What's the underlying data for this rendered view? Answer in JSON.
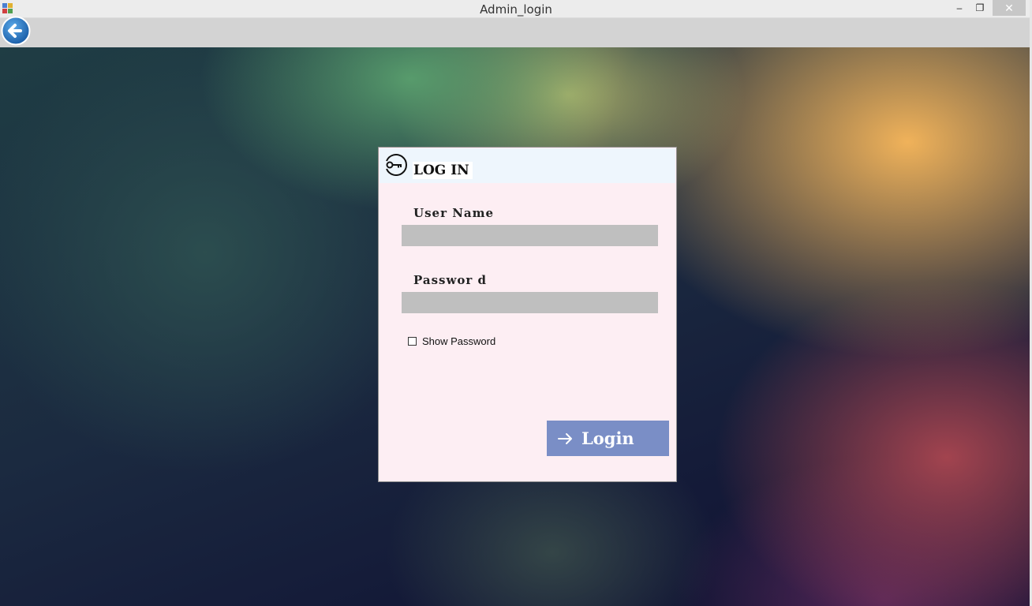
{
  "window": {
    "title": "Admin_login",
    "controls": {
      "minimize": "–",
      "maximize": "❐",
      "close": "✕"
    }
  },
  "toolbar": {
    "back_icon": "back-arrow-icon"
  },
  "login_panel": {
    "header_icon": "key-icon",
    "title": "LOG IN",
    "username": {
      "label": "User Name",
      "value": ""
    },
    "password": {
      "label": "Passwor d",
      "value": ""
    },
    "show_password": {
      "label": "Show Password",
      "checked": false
    },
    "login_button": {
      "icon": "arrow-right-icon",
      "label": "Login"
    }
  },
  "colors": {
    "panel_bg": "#fdeef3",
    "header_bg": "#eef6fd",
    "field_bg": "#bfbfbf",
    "button_bg": "#7a8ec6",
    "toolbar_bg": "#d3d3d3"
  }
}
